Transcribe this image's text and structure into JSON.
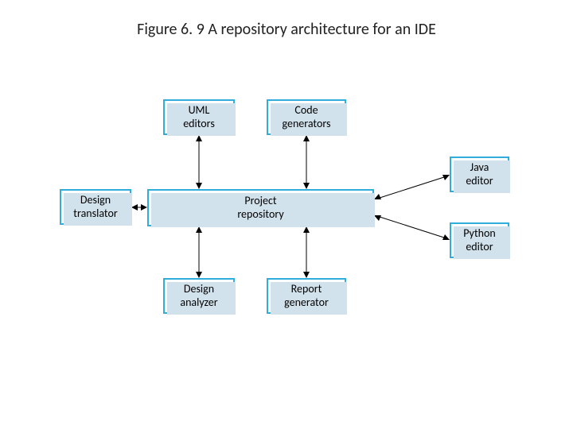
{
  "title": "Figure 6. 9 A repository architecture for an IDE",
  "boxes": {
    "uml_editors": "UML\neditors",
    "code_generators": "Code\ngenerators",
    "java_editor": "Java\neditor",
    "design_translator": "Design\ntranslator",
    "project_repository": "Project\nrepository",
    "python_editor": "Python\neditor",
    "design_analyzer": "Design\nanalyzer",
    "report_generator": "Report\ngenerator"
  },
  "diagram_semantics": {
    "pattern": "repository-architecture",
    "hub": "project_repository",
    "clients": [
      "uml_editors",
      "code_generators",
      "java_editor",
      "design_translator",
      "python_editor",
      "design_analyzer",
      "report_generator"
    ],
    "connections_bidirectional": true
  }
}
